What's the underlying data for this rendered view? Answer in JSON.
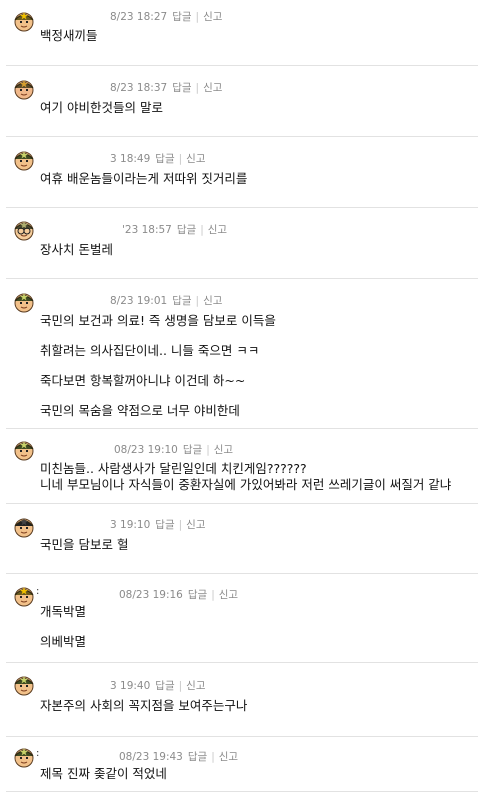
{
  "comments": [
    {
      "date": "8/23 18:27",
      "reply": "답글",
      "report": "신고",
      "avatar_style": "gold",
      "lines": [
        "백정새끼들"
      ]
    },
    {
      "date": "8/23 18:37",
      "reply": "답글",
      "report": "신고",
      "avatar_style": "brown",
      "lines": [
        "여기 야비한것들의 말로"
      ]
    },
    {
      "date": "3 18:49",
      "reply": "답글",
      "report": "신고",
      "avatar_style": "green",
      "lines": [
        "여휴 배운놈들이라는게 저따위 짓거리를"
      ]
    },
    {
      "date": "'23 18:57",
      "reply": "답글",
      "report": "신고",
      "avatar_style": "glasses",
      "lines": [
        "장사치 돈벌레"
      ]
    },
    {
      "date": "8/23 19:01",
      "reply": "답글",
      "report": "신고",
      "avatar_style": "green",
      "lines": [
        "국민의 보건과 의료! 즉 생명을 담보로 이득을",
        "취할려는 의사집단이네.. 니들 죽으면 ㅋㅋ",
        "죽다보면 항복할꺼아니냐 이건데 하~~",
        "국민의 목숨을 약점으로 너무 야비한데"
      ]
    },
    {
      "date": "08/23 19:10",
      "reply": "답글",
      "report": "신고",
      "avatar_style": "green",
      "lines": [
        "미친놈들.. 사람생사가 달린일인데 치킨게임??????",
        "니네 부모님이나 자식들이 중환자실에 가있어봐라 저런 쓰레기글이 써질거 같냐"
      ]
    },
    {
      "date": "3 19:10",
      "reply": "답글",
      "report": "신고",
      "avatar_style": "plain",
      "lines": [
        "국민을 담보로 헐"
      ]
    },
    {
      "nick": ":",
      "date": "08/23 19:16",
      "reply": "답글",
      "report": "신고",
      "avatar_style": "gold",
      "lines": [
        "개독박멸",
        "의베박멸"
      ]
    },
    {
      "date": "3 19:40",
      "reply": "답글",
      "report": "신고",
      "avatar_style": "green",
      "lines": [
        "자본주의 사회의 꼭지점을 보여주는구나"
      ]
    },
    {
      "nick": ":",
      "date": "08/23 19:43",
      "reply": "답글",
      "report": "신고",
      "avatar_style": "green",
      "lines": [
        "제목 진짜 좆같이 적었네"
      ]
    }
  ]
}
